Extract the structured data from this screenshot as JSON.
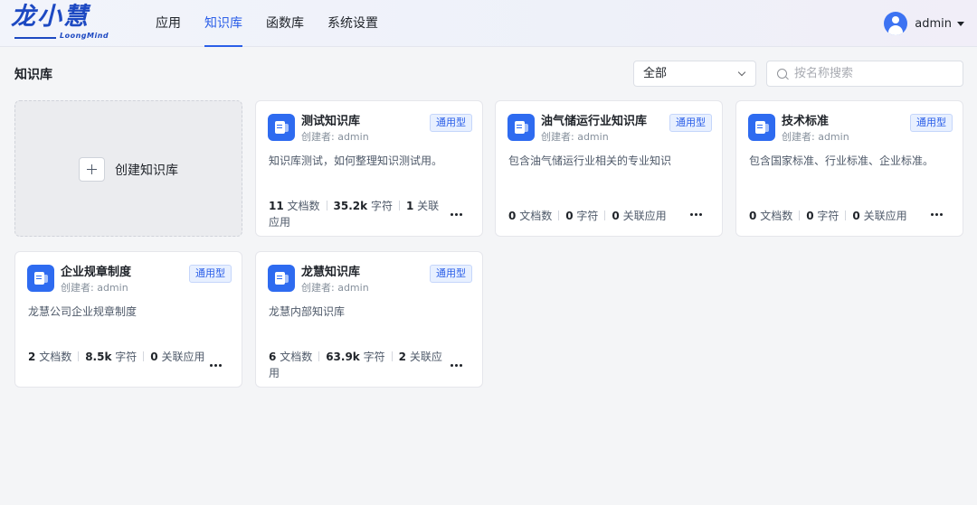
{
  "brand": {
    "logo_text": "龙小慧",
    "logo_sub": "LoongMind"
  },
  "nav": [
    {
      "label": "应用",
      "active": false
    },
    {
      "label": "知识库",
      "active": true
    },
    {
      "label": "函数库",
      "active": false
    },
    {
      "label": "系统设置",
      "active": false
    }
  ],
  "user": {
    "name": "admin"
  },
  "page": {
    "title": "知识库"
  },
  "filter": {
    "value": "全部"
  },
  "search": {
    "placeholder": "按名称搜索"
  },
  "create": {
    "label": "创建知识库"
  },
  "colors": {
    "accent": "#2a5ee8",
    "icon_bg": "#2e6bf0",
    "tag_bg": "#e8f0ff"
  },
  "cards": [
    {
      "name": "测试知识库",
      "creator": "创建者: admin",
      "tag": "通用型",
      "desc": "知识库测试，如何整理知识测试用。",
      "docs": "11",
      "docs_label": "文档数",
      "chars": "35.2k",
      "chars_label": "字符",
      "apps": "1",
      "apps_label": "关联应用"
    },
    {
      "name": "油气储运行业知识库",
      "creator": "创建者: admin",
      "tag": "通用型",
      "desc": "包含油气储运行业相关的专业知识",
      "docs": "0",
      "docs_label": "文档数",
      "chars": "0",
      "chars_label": "字符",
      "apps": "0",
      "apps_label": "关联应用"
    },
    {
      "name": "技术标准",
      "creator": "创建者: admin",
      "tag": "通用型",
      "desc": "包含国家标准、行业标准、企业标准。",
      "docs": "0",
      "docs_label": "文档数",
      "chars": "0",
      "chars_label": "字符",
      "apps": "0",
      "apps_label": "关联应用"
    },
    {
      "name": "企业规章制度",
      "creator": "创建者: admin",
      "tag": "通用型",
      "desc": "龙慧公司企业规章制度",
      "docs": "2",
      "docs_label": "文档数",
      "chars": "8.5k",
      "chars_label": "字符",
      "apps": "0",
      "apps_label": "关联应用"
    },
    {
      "name": "龙慧知识库",
      "creator": "创建者: admin",
      "tag": "通用型",
      "desc": "龙慧内部知识库",
      "docs": "6",
      "docs_label": "文档数",
      "chars": "63.9k",
      "chars_label": "字符",
      "apps": "2",
      "apps_label": "关联应用"
    }
  ]
}
